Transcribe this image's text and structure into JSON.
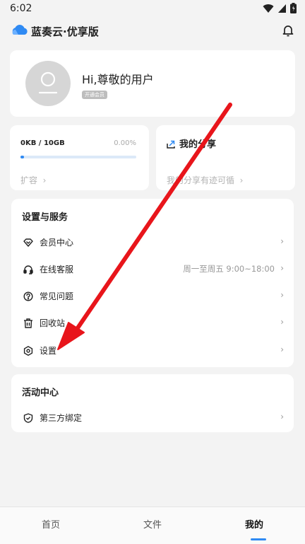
{
  "status_bar": {
    "time": "6:02"
  },
  "app": {
    "title": "蓝奏云·优享版"
  },
  "profile": {
    "greeting": "Hi,尊敬的用户",
    "member_badge": "开通会员"
  },
  "storage": {
    "used": "0KB / 10GB",
    "percent_text": "0.00%",
    "progress_percent": 0,
    "expand_label": "扩容"
  },
  "share": {
    "title": "我的分享",
    "subtitle": "我的分享有迹可循"
  },
  "services": {
    "title": "设置与服务",
    "items": [
      {
        "label": "会员中心",
        "icon": "diamond-icon"
      },
      {
        "label": "在线客服",
        "icon": "headset-icon",
        "extra": "周一至周五 9:00~18:00"
      },
      {
        "label": "常见问题",
        "icon": "question-icon"
      },
      {
        "label": "回收站",
        "icon": "trash-icon"
      },
      {
        "label": "设置",
        "icon": "settings-icon"
      }
    ]
  },
  "activity": {
    "title": "活动中心",
    "items": [
      {
        "label": "第三方绑定",
        "icon": "shield-icon"
      }
    ]
  },
  "nav": {
    "home": "首页",
    "files": "文件",
    "mine": "我的"
  },
  "colors": {
    "accent": "#2f8af3",
    "annotation_arrow": "#e8151b"
  }
}
